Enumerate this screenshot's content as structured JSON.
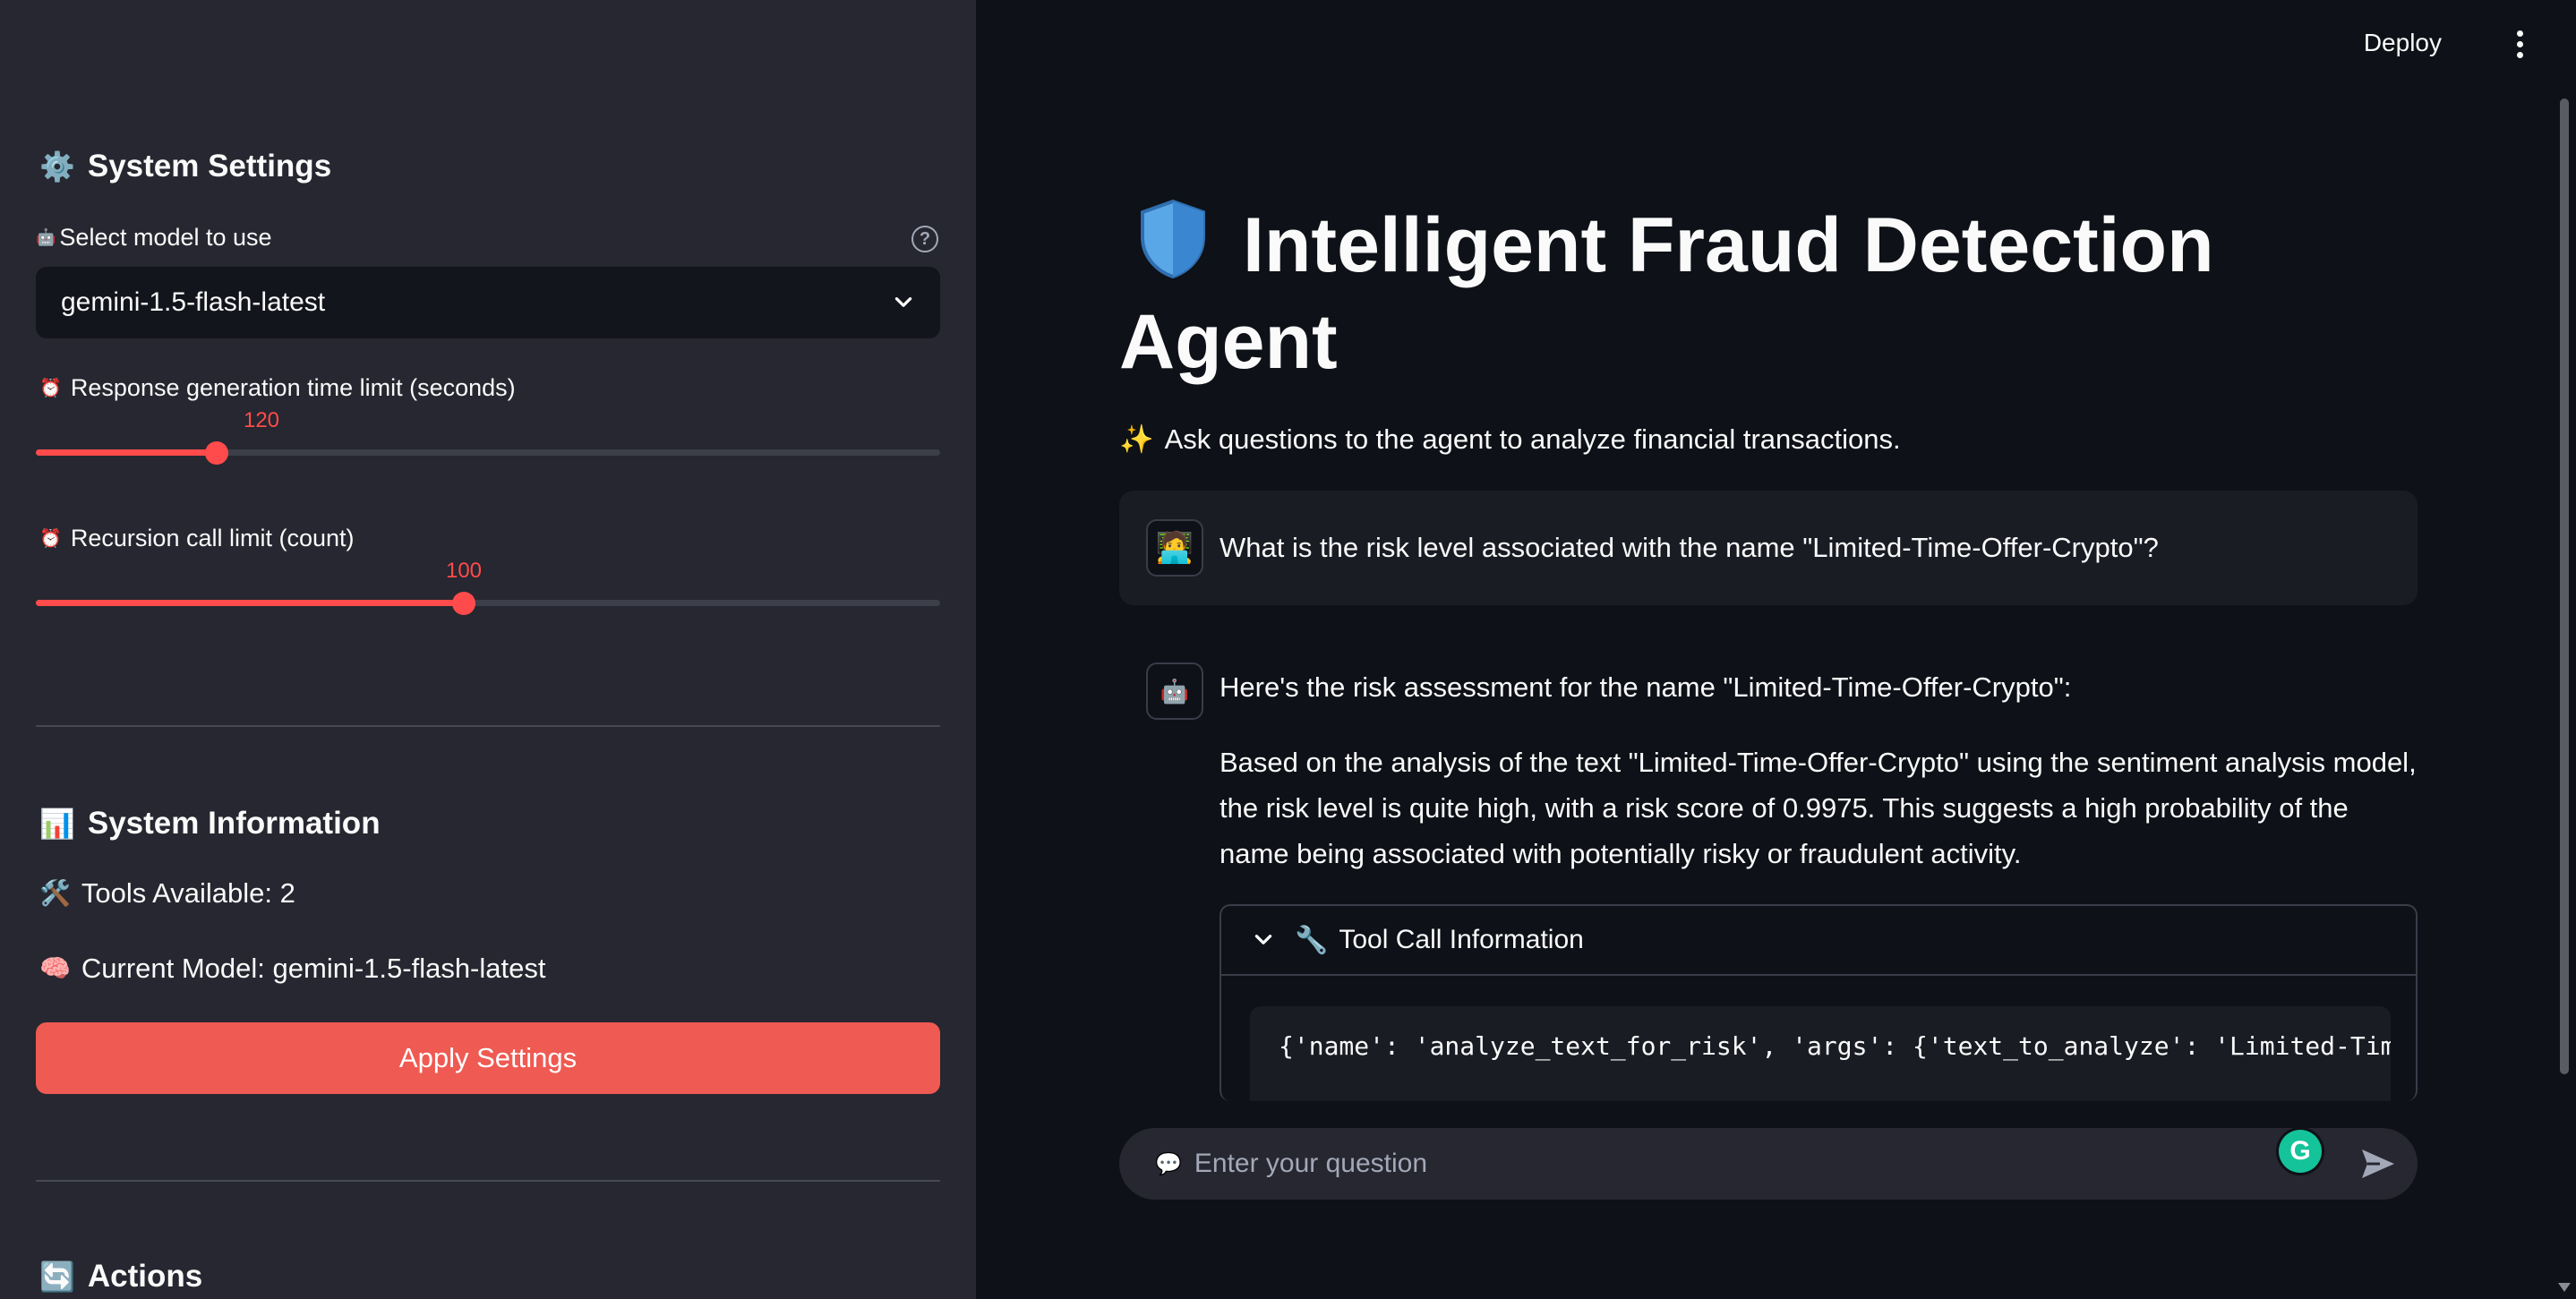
{
  "sidebar": {
    "system_settings": {
      "icon": "⚙️",
      "title": "System Settings"
    },
    "model_select": {
      "icon": "🤖",
      "label": "Select model to use",
      "value": "gemini-1.5-flash-latest"
    },
    "time_limit": {
      "icon": "⏰",
      "label": "Response generation time limit (seconds)",
      "value": "120",
      "fraction": 0.2
    },
    "recursion_limit": {
      "icon": "⏰",
      "label": "Recursion call limit (count)",
      "value": "100",
      "fraction": 0.4737
    },
    "system_info": {
      "icon": "📊",
      "title": "System Information"
    },
    "tools": {
      "icon": "🛠️",
      "text": "Tools Available: 2"
    },
    "current_model": {
      "icon": "🧠",
      "text": "Current Model: gemini-1.5-flash-latest"
    },
    "apply_button": "Apply Settings",
    "actions": {
      "icon": "🔄",
      "title": "Actions"
    }
  },
  "header": {
    "deploy_label": "Deploy"
  },
  "main": {
    "title_icon": "shield",
    "title": "Intelligent Fraud Detection Agent",
    "subtitle_icon": "✨",
    "subtitle": "Ask questions to the agent to analyze financial transactions.",
    "user_message": {
      "avatar": "🧑‍💻",
      "text": "What is the risk level associated with the name \"Limited-Time-Offer-Crypto\"?"
    },
    "assistant_message": {
      "avatar": "🤖",
      "intro": "Here's the risk assessment for the name \"Limited-Time-Offer-Crypto\":",
      "body": "Based on the analysis of the text \"Limited-Time-Offer-Crypto\" using the sentiment analysis model, the risk level is quite high, with a risk score of 0.9975. This suggests a high probability of the name being associated with potentially risky or fraudulent activity."
    },
    "tool_expander": {
      "icon": "🔧",
      "title": "Tool Call Information",
      "code": "{'name': 'analyze_text_for_risk', 'args': {'text_to_analyze': 'Limited-Time-Offer-Crypto'}}"
    },
    "chat_input": {
      "icon": "💬",
      "placeholder": "Enter your question"
    }
  },
  "colors": {
    "accent": "#ff4b4b",
    "button": "#ef5a52",
    "sidebar_bg": "#262730",
    "main_bg": "#0e1117"
  }
}
